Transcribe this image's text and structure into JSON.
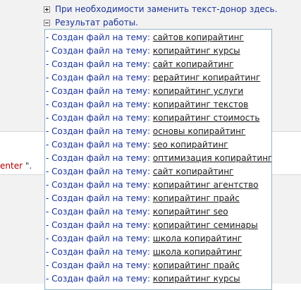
{
  "tree": {
    "replace_donor_label": "При необходимости заменить текст-донор здесь.",
    "results_label": "Результат работы."
  },
  "results": {
    "prefix": "- Создан файл на тему: ",
    "items": [
      "сайтов копирайтинг",
      "копирайтинг курсы",
      "сайт копирайтинг",
      "рерайтинг копирайтинг",
      "копирайтинг услуги",
      "копирайтинг текстов",
      "копирайтинг стоимость",
      "основы копирайтинг",
      "seo копирайтинг",
      "оптимизация копирайтинг",
      "сайт копирайтинг",
      "копирайтинг агентство",
      "копирайтинг прайс",
      "копирайтинг seo",
      "копирайтинг семинары",
      "школа копирайтинг",
      "школа копирайтинг",
      "копирайтинг прайс",
      "копирайтинг курсы"
    ]
  },
  "background_text": {
    "keyword": "enter",
    "tail": " \"."
  },
  "colors": {
    "label_blue": "#1a3399",
    "panel_border": "#8fb6c6",
    "keyword_red": "#b00000"
  }
}
